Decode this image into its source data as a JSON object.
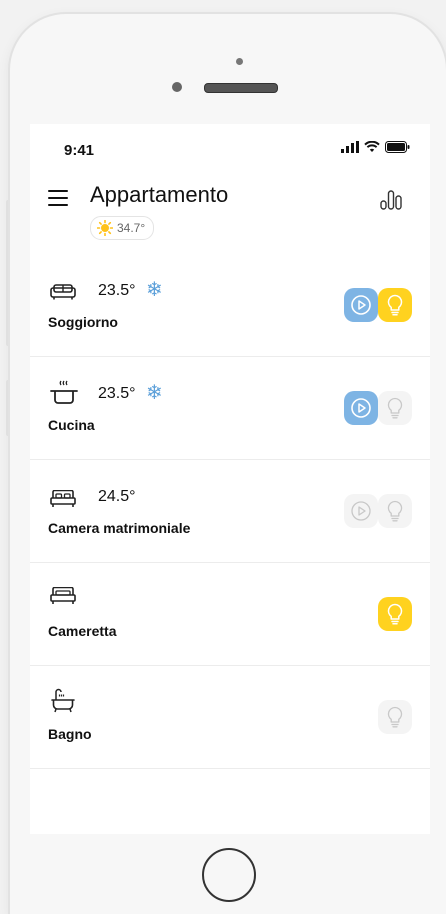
{
  "status_bar": {
    "time": "9:41"
  },
  "header": {
    "title": "Appartamento",
    "weather_temp": "34.7°"
  },
  "colors": {
    "accent_blue": "#7eb4e4",
    "accent_yellow": "#ffd21f",
    "snow_blue": "#5b9fd9"
  },
  "rooms": [
    {
      "name": "Soggiorno",
      "temp": "23.5°",
      "icon": "sofa-icon",
      "cooling": true,
      "scene_on": true,
      "light_on": true
    },
    {
      "name": "Cucina",
      "temp": "23.5°",
      "icon": "cooking-pot-icon",
      "cooling": true,
      "scene_on": true,
      "light_on": false
    },
    {
      "name": "Camera matrimoniale",
      "temp": "24.5°",
      "icon": "double-bed-icon",
      "cooling": false,
      "scene_on": false,
      "light_on": false
    },
    {
      "name": "Cameretta",
      "temp": "",
      "icon": "bed-icon",
      "cooling": false,
      "scene_on": null,
      "light_on": true
    },
    {
      "name": "Bagno",
      "temp": "",
      "icon": "bathtub-icon",
      "cooling": false,
      "scene_on": null,
      "light_on": false
    }
  ]
}
